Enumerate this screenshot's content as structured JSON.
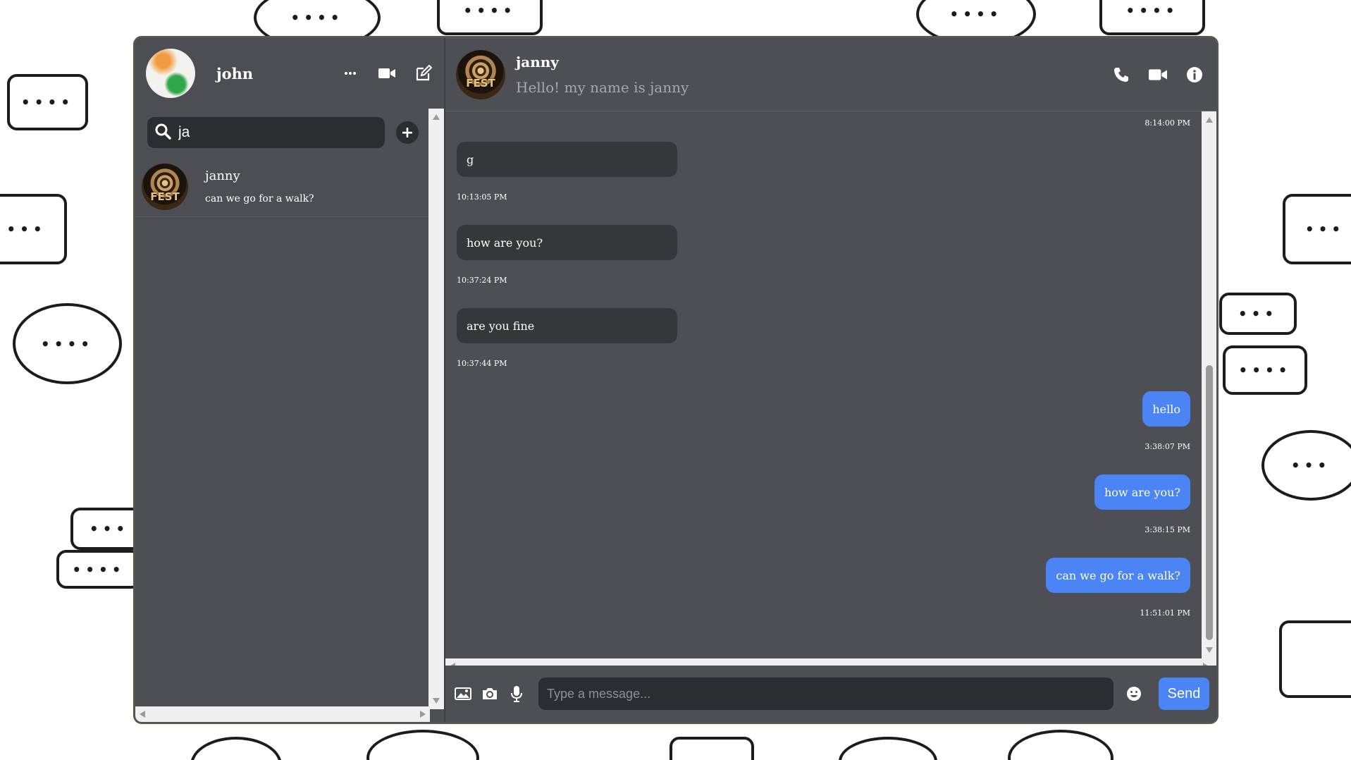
{
  "sidebar": {
    "user_name": "john",
    "search_value": "ja",
    "conversations": [
      {
        "name": "janny",
        "last_message": "can we go for a walk?"
      }
    ]
  },
  "chat": {
    "peer_name": "janny",
    "peer_status": "Hello! my name is janny",
    "top_timestamp": "8:14:00 PM",
    "messages": [
      {
        "direction": "in",
        "text": "g",
        "time": "10:13:05 PM"
      },
      {
        "direction": "in",
        "text": "how are you?",
        "time": "10:37:24 PM"
      },
      {
        "direction": "in",
        "text": "are you fine",
        "time": "10:37:44 PM"
      },
      {
        "direction": "out",
        "text": "hello",
        "time": "3:38:07 PM"
      },
      {
        "direction": "out",
        "text": "how are you?",
        "time": "3:38:15 PM"
      },
      {
        "direction": "out",
        "text": "can we go for a walk?",
        "time": "11:51:01 PM"
      }
    ],
    "composer": {
      "placeholder": "Type a message...",
      "send_label": "Send"
    }
  },
  "icons": [
    "search-icon",
    "add-icon",
    "more-icon",
    "video-icon",
    "compose-icon",
    "phone-icon",
    "info-icon",
    "image-icon",
    "camera-icon",
    "mic-icon",
    "emoji-icon"
  ],
  "colors": {
    "accent": "#4b84f4",
    "panel": "#4e4f55",
    "input": "#2c2d31"
  }
}
